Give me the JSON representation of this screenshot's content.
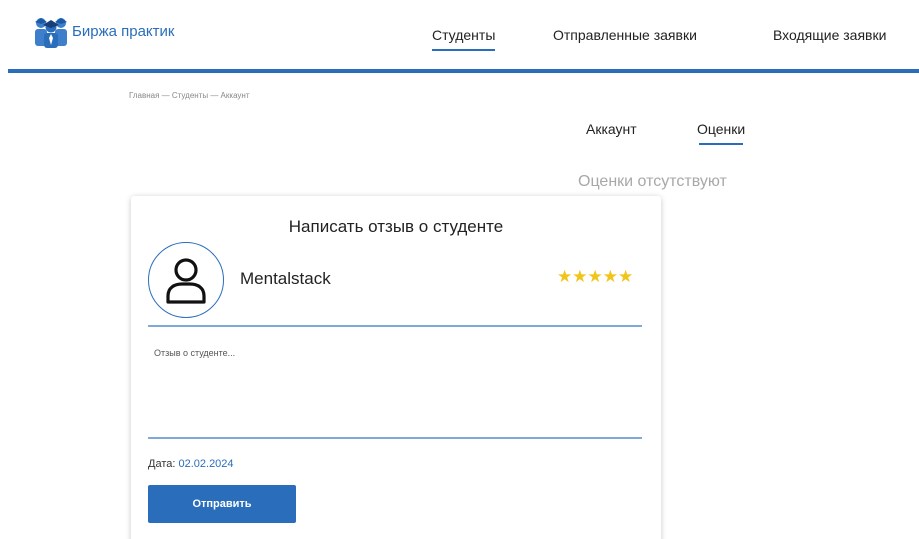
{
  "header": {
    "logo_text": "Биржа практик",
    "logo_icon": "students-group-icon",
    "brand_color": "#2a6ebb",
    "nav": [
      {
        "label": "Студенты",
        "active": true
      },
      {
        "label": "Отправленные заявки",
        "active": false
      },
      {
        "label": "Входящие заявки",
        "active": false
      }
    ]
  },
  "breadcrumb": "Главная — Студенты — Аккаунт",
  "tabs": [
    {
      "label": "Аккаунт",
      "active": false
    },
    {
      "label": "Оценки",
      "active": true
    }
  ],
  "ratings_empty_text": "Оценки отсутствуют",
  "review_card": {
    "title": "Написать отзыв о студенте",
    "avatar_icon": "user-icon",
    "student_name": "Mentalstack",
    "stars": {
      "value": 5,
      "max": 5,
      "color": "#f0c419"
    },
    "review_placeholder": "Отзыв о студенте...",
    "review_value": "",
    "date_label": "Дата:",
    "date_value": "02.02.2024",
    "submit_label": "Отправить"
  }
}
